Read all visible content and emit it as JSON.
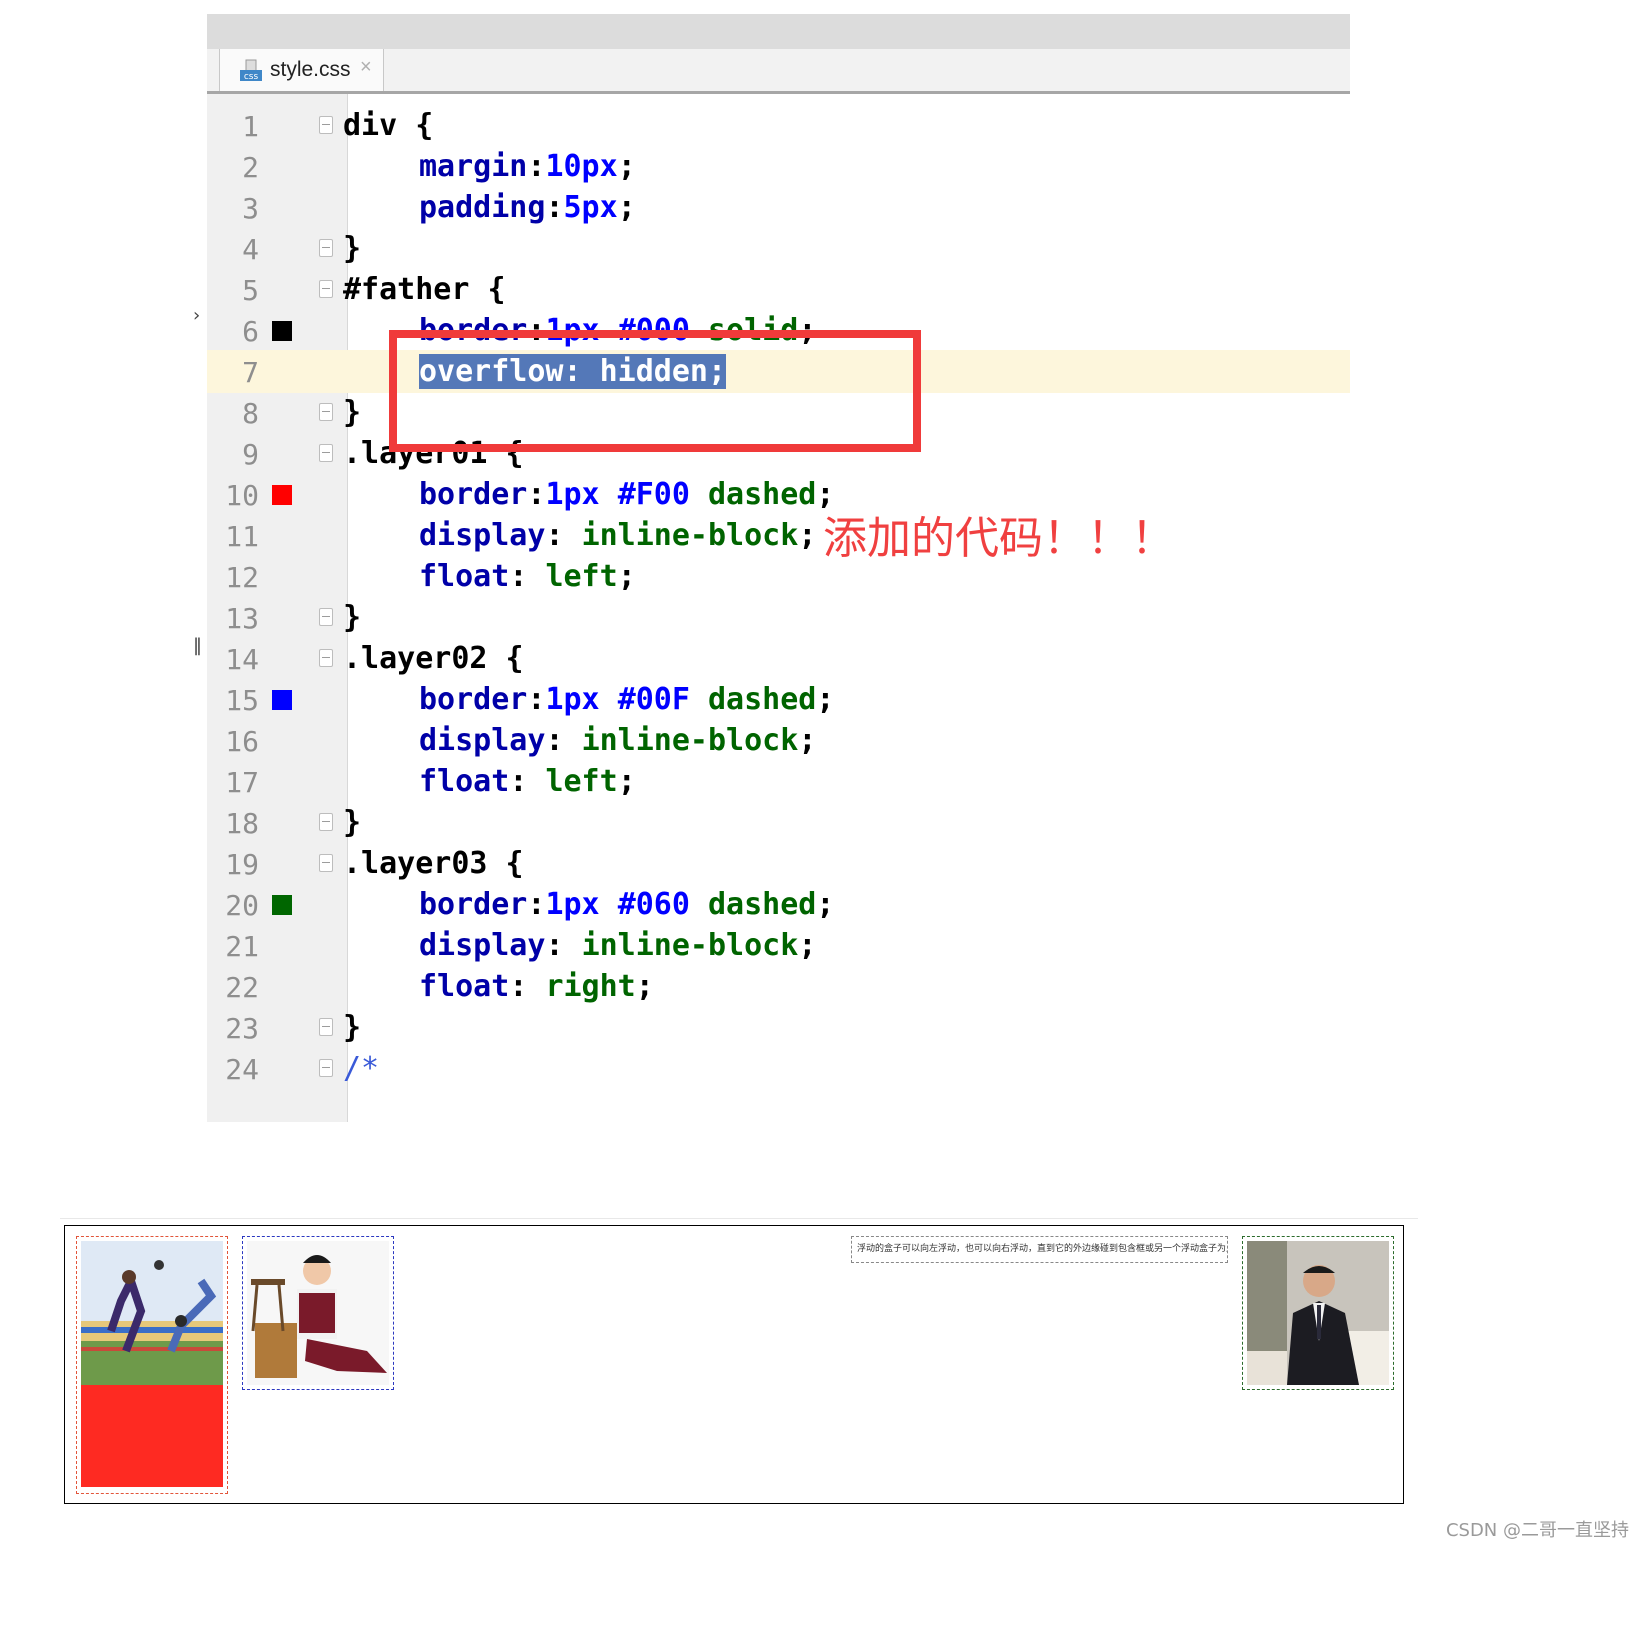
{
  "tab": {
    "file_name": "style.css",
    "icon_label": "css",
    "close_glyph": "×"
  },
  "editor": {
    "lines": [
      {
        "n": "1"
      },
      {
        "n": "2"
      },
      {
        "n": "3"
      },
      {
        "n": "4"
      },
      {
        "n": "5"
      },
      {
        "n": "6"
      },
      {
        "n": "7"
      },
      {
        "n": "8"
      },
      {
        "n": "9"
      },
      {
        "n": "10"
      },
      {
        "n": "11"
      },
      {
        "n": "12"
      },
      {
        "n": "13"
      },
      {
        "n": "14"
      },
      {
        "n": "15"
      },
      {
        "n": "16"
      },
      {
        "n": "17"
      },
      {
        "n": "18"
      },
      {
        "n": "19"
      },
      {
        "n": "20"
      },
      {
        "n": "21"
      },
      {
        "n": "22"
      },
      {
        "n": "23"
      },
      {
        "n": "24"
      }
    ],
    "code": {
      "l1_sel": "div",
      "l1_brace": " {",
      "l2_prop": "margin",
      "l2_colon": ":",
      "l2_val": "10px",
      "l2_end": ";",
      "l3_prop": "padding",
      "l3_colon": ":",
      "l3_val": "5px",
      "l3_end": ";",
      "l4": "}",
      "l5_sel": "#father",
      "l5_brace": " {",
      "l6_prop": "border",
      "l6_colon": ":",
      "l6_num": "1px",
      "l6_sp1": " ",
      "l6_color": "#000",
      "l6_sp2": " ",
      "l6_val": "solid",
      "l6_end": ";",
      "l7": "overflow: hidden;",
      "l8": "}",
      "l9_sel": ".layer01",
      "l9_brace": " {",
      "l10_prop": "border",
      "l10_colon": ":",
      "l10_num": "1px",
      "l10_sp1": " ",
      "l10_color": "#F00",
      "l10_sp2": " ",
      "l10_val": "dashed",
      "l10_end": ";",
      "l11_prop": "display",
      "l11_colon": ": ",
      "l11_val": "inline-block",
      "l11_end": ";",
      "l12_prop": "float",
      "l12_colon": ": ",
      "l12_val": "left",
      "l12_end": ";",
      "l13": "}",
      "l14_sel": ".layer02",
      "l14_brace": " {",
      "l15_prop": "border",
      "l15_colon": ":",
      "l15_num": "1px",
      "l15_sp1": " ",
      "l15_color": "#00F",
      "l15_sp2": " ",
      "l15_val": "dashed",
      "l15_end": ";",
      "l16_prop": "display",
      "l16_colon": ": ",
      "l16_val": "inline-block",
      "l16_end": ";",
      "l17_prop": "float",
      "l17_colon": ": ",
      "l17_val": "left",
      "l17_end": ";",
      "l18": "}",
      "l19_sel": ".layer03",
      "l19_brace": " {",
      "l20_prop": "border",
      "l20_colon": ":",
      "l20_num": "1px",
      "l20_sp1": " ",
      "l20_color": "#060",
      "l20_sp2": " ",
      "l20_val": "dashed",
      "l20_end": ";",
      "l21_prop": "display",
      "l21_colon": ": ",
      "l21_val": "inline-block",
      "l21_end": ";",
      "l22_prop": "float",
      "l22_colon": ": ",
      "l22_val": "right",
      "l22_end": ";",
      "l23": "}",
      "l24": "/*"
    },
    "swatches": {
      "line6": "#000000",
      "line10": "#FF0000",
      "line15": "#0000FF",
      "line20": "#006600"
    },
    "gutter_marks": {
      "m6": "›",
      "m14": "‖"
    }
  },
  "annotation": {
    "text": "添加的代码！！！",
    "color": "#f04040"
  },
  "preview": {
    "float_text": "浮动的盒子可以向左浮动，也可以向右浮动，直到它的外边缘碰到包含框或另一个浮动盒子为止。"
  },
  "watermark": "CSDN @二哥一直坚持"
}
